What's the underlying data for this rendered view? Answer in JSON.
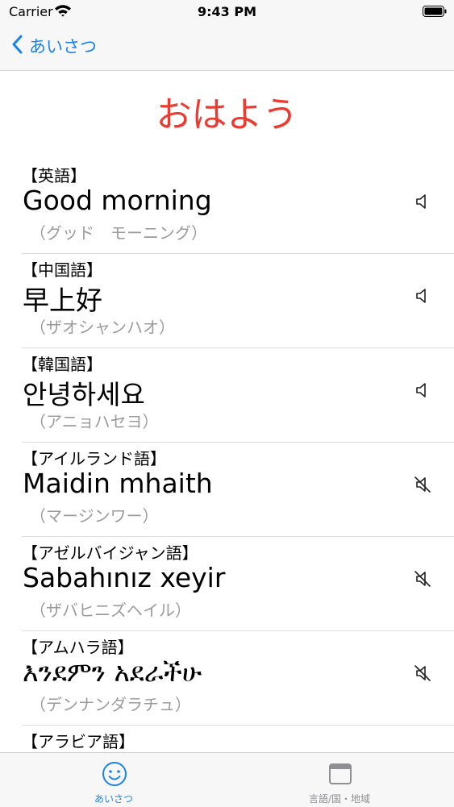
{
  "status_bar": {
    "carrier": "Carrier",
    "time": "9:43 PM",
    "wifi_icon": "wifi-icon",
    "battery_icon": "battery-icon"
  },
  "nav": {
    "back_label": "あいさつ",
    "back_icon": "chevron-left-icon"
  },
  "page": {
    "title": "おはよう",
    "title_color": "#ec3b30"
  },
  "phrases": [
    {
      "language": "【英語】",
      "phrase": "Good morning",
      "reading": "（グッド　モーニング）",
      "audio": "available"
    },
    {
      "language": "【中国語】",
      "phrase": "早上好",
      "reading": "（ザオシャンハオ）",
      "audio": "available"
    },
    {
      "language": "【韓国語】",
      "phrase": "안녕하세요",
      "reading": "（アニョハセヨ）",
      "audio": "available"
    },
    {
      "language": "【アイルランド語】",
      "phrase": "Maidin mhaith",
      "reading": "（マージンワー）",
      "audio": "unavailable"
    },
    {
      "language": "【アゼルバイジャン語】",
      "phrase": "Sabahınız xeyir",
      "reading": "（ザバヒニズヘイル）",
      "audio": "unavailable"
    },
    {
      "language": "【アムハラ語】",
      "phrase": "እንደምን አደራችሁ",
      "reading": "（デンナンダラチュ）",
      "audio": "unavailable"
    },
    {
      "language": "【アラビア語】",
      "phrase": "",
      "reading": "",
      "audio": ""
    }
  ],
  "tabs": [
    {
      "label": "あいさつ",
      "icon": "smiley-icon",
      "selected": true
    },
    {
      "label": "言語/国・地域",
      "icon": "window-icon",
      "selected": false
    }
  ],
  "colors": {
    "accent": "#1a82f0",
    "inactive_tab": "#8e8e93",
    "reading": "#9b9b9b"
  }
}
